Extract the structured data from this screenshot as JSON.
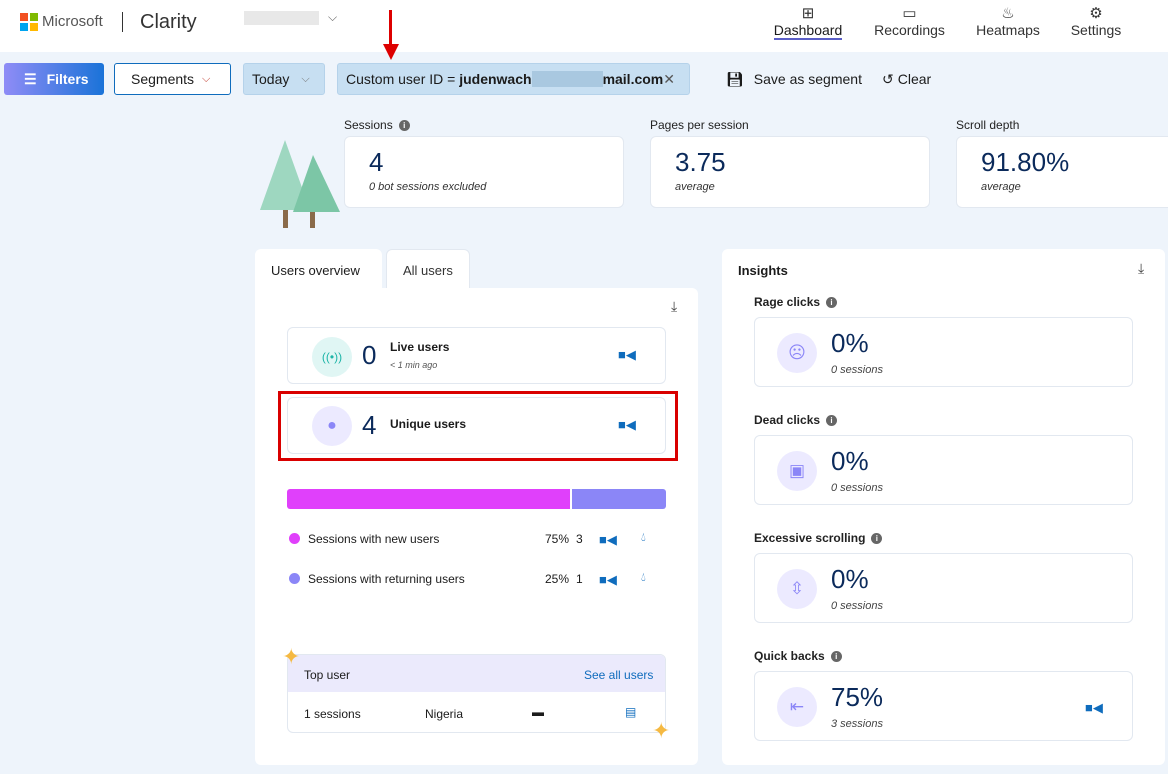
{
  "header": {
    "brand": "Microsoft",
    "product": "Clarity",
    "nav": [
      {
        "label": "Dashboard",
        "icon": "dashboard-icon",
        "active": true
      },
      {
        "label": "Recordings",
        "icon": "video-icon"
      },
      {
        "label": "Heatmaps",
        "icon": "flame-icon"
      },
      {
        "label": "Settings",
        "icon": "gear-icon"
      }
    ]
  },
  "toolbar": {
    "filters": "Filters",
    "segments": "Segments",
    "date": "Today",
    "filter_chip_prefix": "Custom user ID = ",
    "filter_chip_value_start": "judenwach",
    "filter_chip_value_end": "mail.com",
    "save_segment": "Save as segment",
    "clear": "Clear"
  },
  "metrics": [
    {
      "label": "Sessions",
      "value": "4",
      "sub": "0 bot sessions excluded"
    },
    {
      "label": "Pages per session",
      "value": "3.75",
      "sub": "average"
    },
    {
      "label": "Scroll depth",
      "value": "91.80%",
      "sub": "average"
    }
  ],
  "users": {
    "tabs": [
      "Users overview",
      "All users"
    ],
    "live": {
      "value": "0",
      "label": "Live users",
      "sub": "< 1 min ago"
    },
    "unique": {
      "value": "4",
      "label": "Unique users"
    },
    "split": {
      "new_pct": 75,
      "colors": {
        "new": "#e040fb",
        "returning": "#8b86f7"
      }
    },
    "rows": [
      {
        "label": "Sessions with new users",
        "pct": "75%",
        "count": "3"
      },
      {
        "label": "Sessions with returning users",
        "pct": "25%",
        "count": "1"
      }
    ],
    "top_user": {
      "title": "Top user",
      "link": "See all users",
      "sessions": "1 sessions",
      "country": "Nigeria"
    }
  },
  "insights": {
    "title": "Insights",
    "items": [
      {
        "label": "Rage clicks",
        "value": "0%",
        "sub": "0 sessions",
        "icon": "angry-face-icon"
      },
      {
        "label": "Dead clicks",
        "value": "0%",
        "sub": "0 sessions",
        "icon": "dead-click-icon"
      },
      {
        "label": "Excessive scrolling",
        "value": "0%",
        "sub": "0 sessions",
        "icon": "scroll-icon"
      },
      {
        "label": "Quick backs",
        "value": "75%",
        "sub": "3 sessions",
        "icon": "quick-back-icon"
      }
    ]
  }
}
